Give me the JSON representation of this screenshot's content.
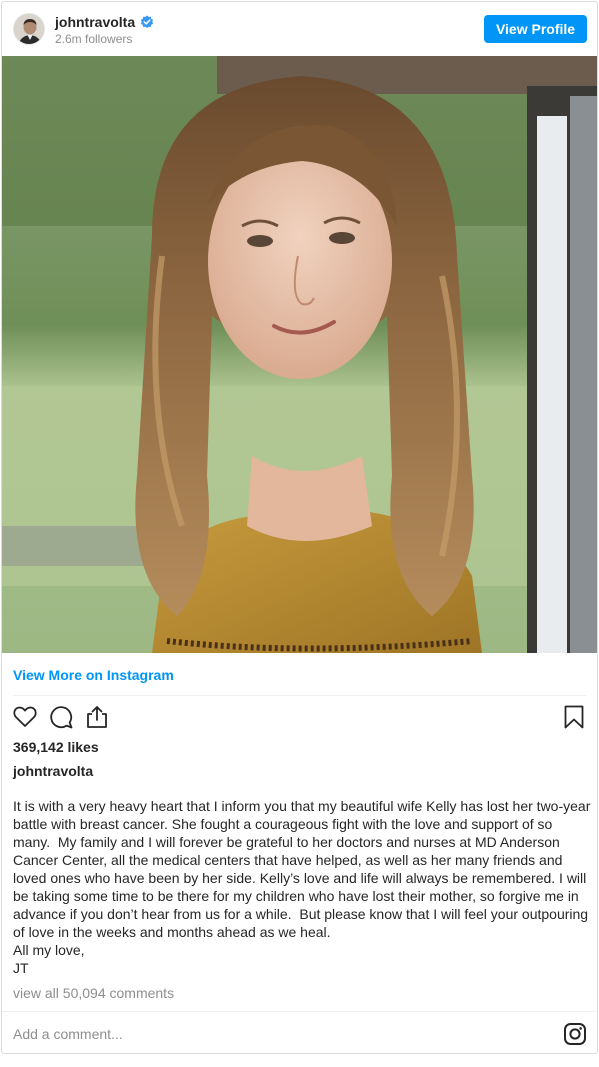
{
  "header": {
    "username": "johntravolta",
    "followers": "2.6m followers",
    "view_profile_label": "View Profile"
  },
  "post": {
    "view_more_label": "View More on Instagram",
    "likes": "369,142 likes",
    "caption_user": "johntravolta",
    "caption": "It is with a very heavy heart that I inform you that my beautiful wife Kelly has lost her two-year battle with breast cancer. She fought a courageous fight with the love and support of so many.  My family and I will forever be grateful to her doctors and nurses at MD Anderson Cancer Center, all the medical centers that have helped, as well as her many friends and loved ones who have been by her side. Kelly’s love and life will always be remembered. I will be taking some time to be there for my children who have lost their mother, so forgive me in advance if you don’t hear from us for a while.  But please know that I will feel your outpouring of love in the weeks and months ahead as we heal.\nAll my love,\nJT",
    "comments_link": "view all 50,094 comments",
    "add_comment_placeholder": "Add a comment..."
  },
  "icons": {
    "like": "heart-icon",
    "comment": "comment-icon",
    "share": "share-icon",
    "save": "bookmark-icon",
    "verified": "verified-badge-icon",
    "brand": "instagram-icon"
  },
  "colors": {
    "accent": "#0095f6",
    "text": "#262626",
    "muted": "#8e8e8e",
    "border": "#dbdbdb"
  }
}
